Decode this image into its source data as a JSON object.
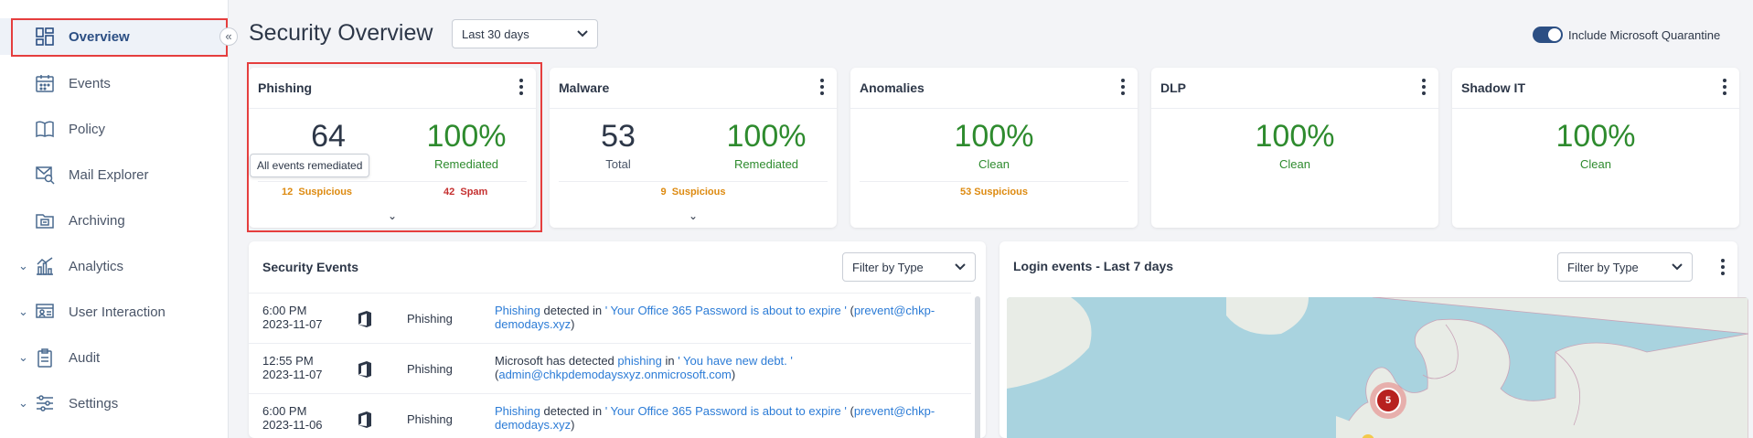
{
  "sidebar": {
    "collapse_icon": "double-chevron-left-icon",
    "items": [
      {
        "label": "Overview",
        "icon": "dashboard-icon",
        "active": true
      },
      {
        "label": "Events",
        "icon": "calendar-icon"
      },
      {
        "label": "Policy",
        "icon": "book-icon"
      },
      {
        "label": "Mail Explorer",
        "icon": "mail-search-icon"
      },
      {
        "label": "Archiving",
        "icon": "archive-icon"
      },
      {
        "label": "Analytics",
        "icon": "analytics-icon",
        "expandable": true
      },
      {
        "label": "User Interaction",
        "icon": "user-interaction-icon",
        "expandable": true
      },
      {
        "label": "Audit",
        "icon": "clipboard-icon",
        "expandable": true
      },
      {
        "label": "Settings",
        "icon": "sliders-icon",
        "expandable": true
      }
    ]
  },
  "header": {
    "title": "Security Overview",
    "range": "Last 30 days",
    "toggle_label": "Include Microsoft Quarantine",
    "toggle_on": true
  },
  "cards": [
    {
      "title": "Phishing",
      "left_value": "64",
      "right_value": "100%",
      "right_label": "Remediated",
      "badge1_count": "12",
      "badge1_label": "Suspicious",
      "badge2_count": "42",
      "badge2_label": "Spam",
      "tooltip": "All events remediated"
    },
    {
      "title": "Malware",
      "left_value": "53",
      "left_label": "Total",
      "right_value": "100%",
      "right_label": "Remediated",
      "badge1_count": "9",
      "badge1_label": "Suspicious"
    },
    {
      "title": "Anomalies",
      "value": "100%",
      "label": "Clean",
      "badge": "53 Suspicious"
    },
    {
      "title": "DLP",
      "value": "100%",
      "label": "Clean"
    },
    {
      "title": "Shadow IT",
      "value": "100%",
      "label": "Clean"
    }
  ],
  "security_events": {
    "title": "Security Events",
    "filter": "Filter by Type",
    "rows": [
      {
        "time": "6:00 PM",
        "date": "2023-11-07",
        "icon": "office-icon",
        "type": "Phishing",
        "d1": "Phishing",
        "d2": " detected in ",
        "d3": "' Your Office 365 Password is about to expire '",
        "d4": " (",
        "d5": "prevent@chkp-demodays.xyz",
        "d6": ")"
      },
      {
        "time": "12:55 PM",
        "date": "2023-11-07",
        "icon": "office-icon",
        "type": "Phishing",
        "d1": "Microsoft has detected ",
        "d2": "phishing",
        "d3": " in ",
        "d4": "' You have new debt. '",
        "d5": "(",
        "d6": "admin@chkpdemodaysxyz.onmicrosoft.com",
        "d7": ")"
      },
      {
        "time": "6:00 PM",
        "date": "2023-11-06",
        "icon": "office-icon",
        "type": "Phishing",
        "d1": "Phishing",
        "d2": " detected in ",
        "d3": "' Your Office 365 Password is about to expire '",
        "d4": " (",
        "d5": "prevent@chkp-demodays.xyz",
        "d6": ")"
      }
    ]
  },
  "login_events": {
    "title": "Login events - Last 7 days",
    "filter": "Filter by Type",
    "cluster_count": "5"
  },
  "colors": {
    "accent": "#2c4f84",
    "highlight": "#e53e3e",
    "green": "#2e8b2e",
    "orange": "#dd8a10",
    "red": "#c53030",
    "link": "#2b7bd6"
  }
}
